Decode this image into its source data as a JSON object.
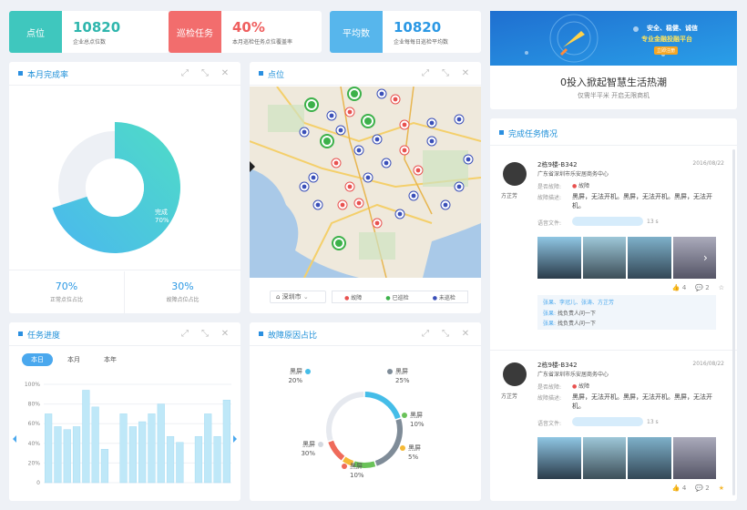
{
  "stats": [
    {
      "label": "点位",
      "value": "10820",
      "desc": "企业总点位数",
      "label_bg": "#3fc7be",
      "value_color": "#2fb6ad"
    },
    {
      "label": "巡检任务",
      "value": "40%",
      "desc": "本月巡检任务点位覆盖率",
      "label_bg": "#f26d6d",
      "value_color": "#ef5f5f"
    },
    {
      "label": "平均数",
      "value": "10820",
      "desc": "企业每每日巡检平均数",
      "label_bg": "#57b6ec",
      "value_color": "#2b98e4"
    }
  ],
  "banner": {
    "image_text_1": "安全、稳健、诚信",
    "image_text_2": "专业金融投融平台",
    "image_text_3": "立即注册",
    "title": "0投入掀起智慧生活热潮",
    "subtitle": "仅需半平米  开启无限商机"
  },
  "completion_panel": {
    "title": "本月完成率",
    "donut_label": "完成",
    "donut_value": "70%",
    "left_value": "70%",
    "left_label": "正常点位占比",
    "right_value": "30%",
    "right_label": "故障点位占比"
  },
  "map_panel": {
    "title": "点位",
    "city": "深圳市",
    "legend": [
      {
        "label": "故障",
        "color": "#e8514f"
      },
      {
        "label": "已巡检",
        "color": "#3cb14a"
      },
      {
        "label": "未巡检",
        "color": "#3a4fb8"
      }
    ]
  },
  "progress_panel": {
    "title": "任务进度",
    "tabs": [
      "本日",
      "本月",
      "本年"
    ],
    "active_tab": 0,
    "y_ticks": [
      "100%",
      "80%",
      "60%",
      "40%",
      "20%",
      "0"
    ],
    "chart_data": {
      "type": "bar",
      "ylim": [
        0,
        100
      ],
      "values": [
        70,
        57,
        54,
        57,
        94,
        77,
        34,
        0,
        70,
        57,
        62,
        70,
        80,
        47,
        41,
        0,
        47,
        70,
        47,
        84
      ]
    }
  },
  "fault_panel": {
    "title": "故障原因占比",
    "chart_data": {
      "type": "pie",
      "slices": [
        {
          "label": "黑屏",
          "value": 25,
          "color": "#7f8c98"
        },
        {
          "label": "黑屏",
          "value": 10,
          "color": "#6ac259"
        },
        {
          "label": "黑屏",
          "value": 5,
          "color": "#f5b935"
        },
        {
          "label": "黑屏",
          "value": 10,
          "color": "#ef6a5a"
        },
        {
          "label": "黑屏",
          "value": 30,
          "color": "#e6e9ef"
        },
        {
          "label": "黑屏",
          "value": 20,
          "color": "#45bde8"
        }
      ]
    },
    "labels": [
      {
        "name": "黑屏",
        "pct": "20%",
        "color": "#45bde8"
      },
      {
        "name": "黑屏",
        "pct": "25%",
        "color": "#7f8c98"
      },
      {
        "name": "黑屏",
        "pct": "10%",
        "color": "#6ac259"
      },
      {
        "name": "黑屏",
        "pct": "5%",
        "color": "#f5b935"
      },
      {
        "name": "黑屏",
        "pct": "10%",
        "color": "#ef6a5a"
      },
      {
        "name": "黑屏",
        "pct": "30%",
        "color": "#d4d8df"
      }
    ]
  },
  "tasks_panel": {
    "title": "完成任务情况",
    "items": [
      {
        "building": "2栋9楼-B342",
        "address": "广东省深圳市乐安居商务中心",
        "date": "2016/08/22",
        "user": "方芷芳",
        "fault_label": "是否故障:",
        "fault_value": "故障",
        "desc_label": "故障描述:",
        "desc": "黑屏，无法开机。黑屏，无法开机。黑屏，无法开机。",
        "voice_label": "语音文件:",
        "voice_len": "13 s",
        "likes": "4",
        "comments": "2",
        "tags": "张果、李冠儿、张涛、方芷芳",
        "replies": [
          {
            "name": "张果:",
            "text": "找负责人问一下"
          },
          {
            "name": "张果:",
            "text": "找负责人问一下"
          }
        ]
      },
      {
        "building": "2栋9楼-B342",
        "address": "广东省深圳市乐安居商务中心",
        "date": "2016/08/22",
        "user": "方芷芳",
        "fault_label": "是否故障:",
        "fault_value": "故障",
        "desc_label": "故障描述:",
        "desc": "黑屏，无法开机。黑屏，无法开机。黑屏，无法开机。",
        "voice_label": "语音文件:",
        "voice_len": "13 s",
        "likes": "4",
        "comments": "2"
      }
    ]
  }
}
